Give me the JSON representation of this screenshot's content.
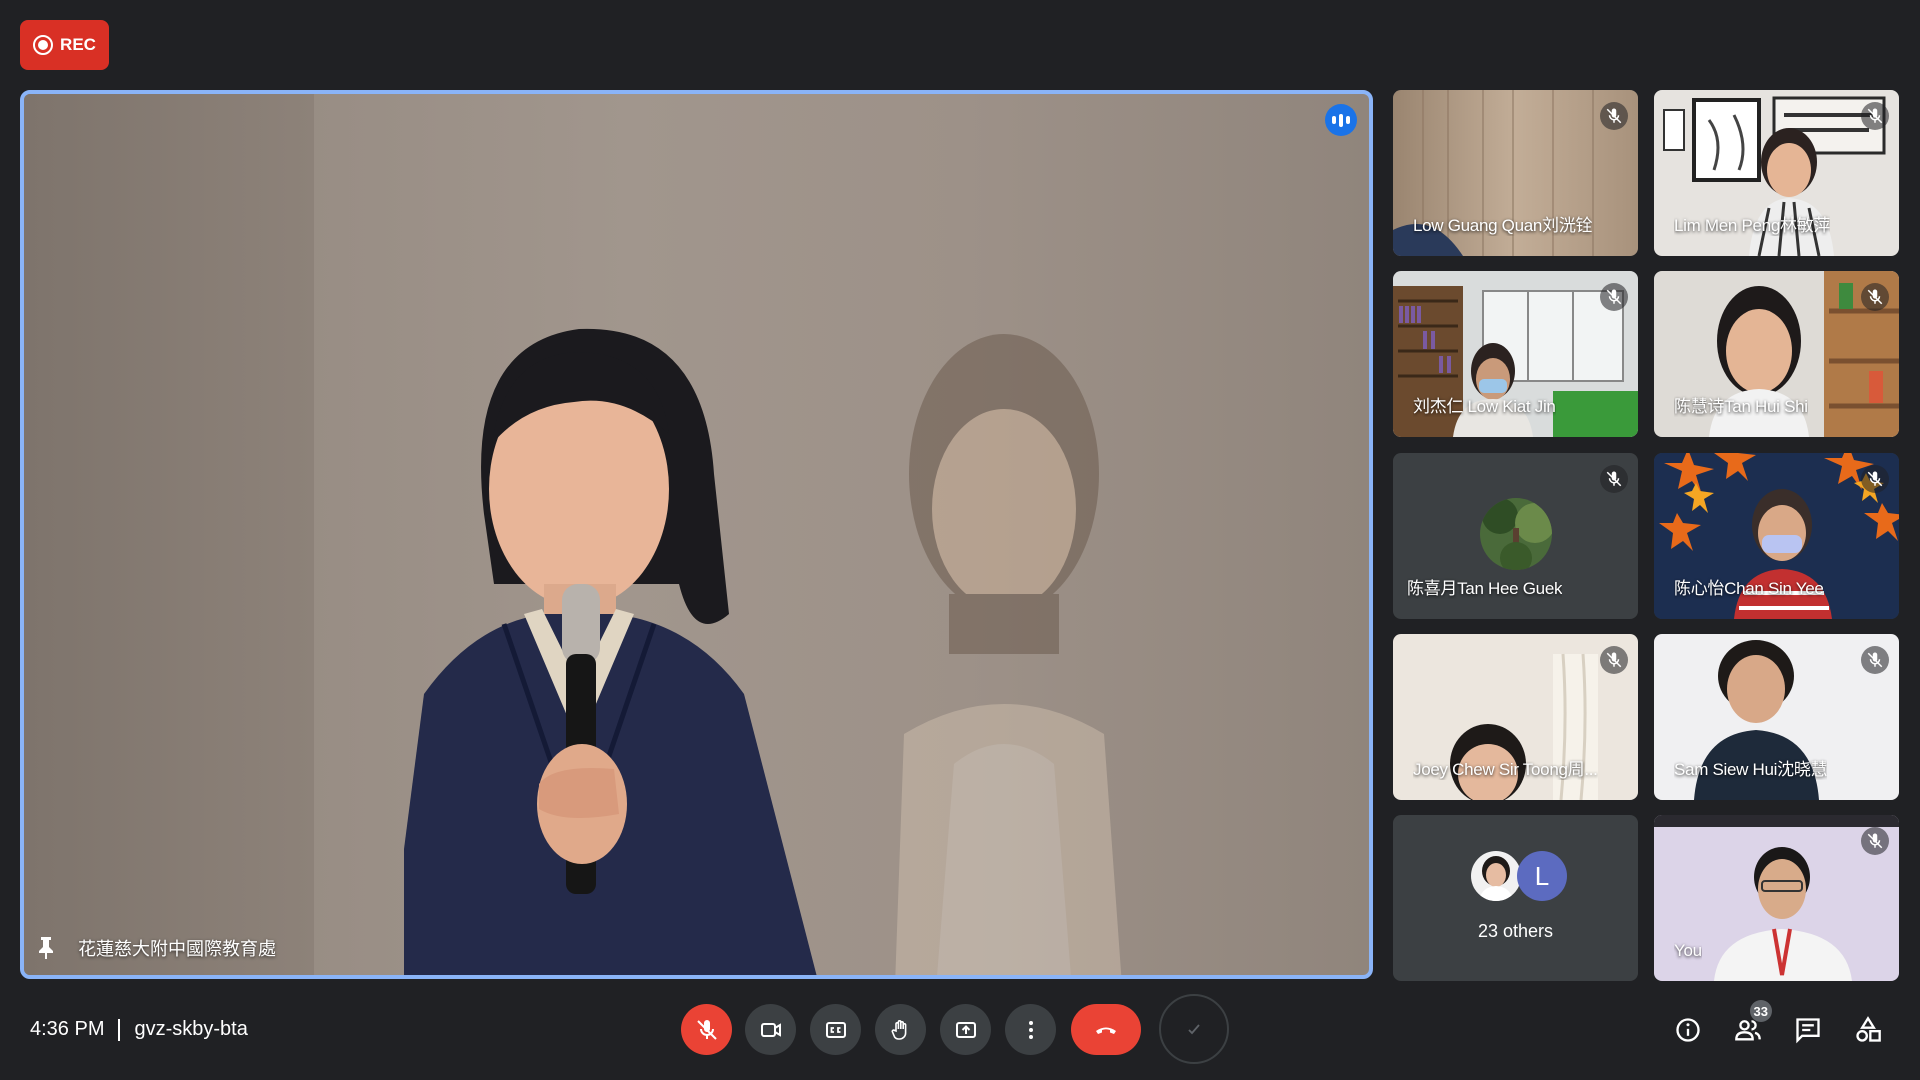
{
  "recording": {
    "label": "REC"
  },
  "main_speaker": {
    "name": "花蓮慈大附中國際教育處"
  },
  "participants": [
    {
      "name": "Low Guang Quan刘洸铨",
      "muted": true
    },
    {
      "name": "Lim Men Peng林敏萍",
      "muted": true
    },
    {
      "name": "刘杰仁 Low Kiat Jin",
      "muted": true
    },
    {
      "name": "陈慧诗Tan Hui Shi",
      "muted": true
    },
    {
      "name": "陈喜月Tan Hee Guek",
      "muted": true
    },
    {
      "name": "陈心怡Chan Sin Yee",
      "muted": true
    },
    {
      "name": "Joey Chew Sir Toong周...",
      "muted": true
    },
    {
      "name": "Sam Siew Hui沈晓慧",
      "muted": true
    },
    {
      "name": "You",
      "muted": true
    }
  ],
  "others": {
    "avatar_letter": "L",
    "label": "23 others"
  },
  "meeting": {
    "time": "4:36 PM",
    "code": "gvz-skby-bta"
  },
  "people_count": "33",
  "icons": {
    "record": "record-icon",
    "pin": "pin-icon",
    "speaking": "speaking-indicator-icon",
    "mic_off": "mic-off-icon",
    "camera": "camera-icon",
    "captions": "captions-icon",
    "raise_hand": "raise-hand-icon",
    "present": "present-screen-icon",
    "more": "more-options-icon",
    "end_call": "end-call-icon",
    "info": "info-icon",
    "people": "people-icon",
    "chat": "chat-icon",
    "activities": "activities-icon"
  },
  "colors": {
    "rec_red": "#d93025",
    "end_red": "#ea4335",
    "active_border": "#8ab4f8",
    "speaking_blue": "#1a73e8",
    "bg": "#202124",
    "tile_bg": "#3c4043"
  }
}
